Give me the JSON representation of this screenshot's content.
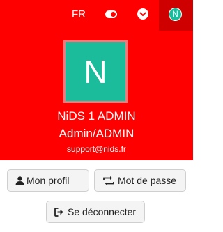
{
  "topbar": {
    "language": "FR",
    "toggle_icon": "toggle-on-icon",
    "menu_icon": "chevron-down-circle-icon",
    "avatar_initial": "N"
  },
  "profile": {
    "avatar_initial": "N",
    "avatar_color": "#1abc9c",
    "name": "NiDS 1 ADMIN",
    "role": "Admin/ADMIN",
    "email": "support@nids.fr"
  },
  "actions": {
    "profile_label": "Mon profil",
    "password_label": "Mot de passe",
    "logout_label": "Se déconnecter"
  },
  "colors": {
    "brand": "#ff0000",
    "avatar_slot": "#cf0000",
    "button_bg": "#f4f4f4"
  }
}
